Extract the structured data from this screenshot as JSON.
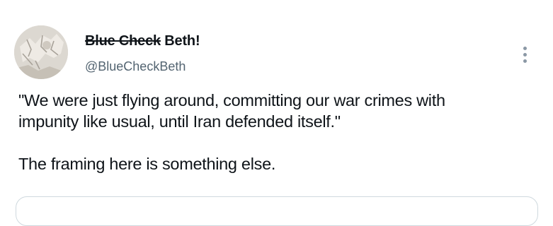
{
  "author": {
    "name_struck": "Blue Check",
    "name_rest": "Beth!",
    "handle": "@BlueCheckBeth",
    "avatar_icon": "avatar-photo-icon"
  },
  "menu": {
    "icon": "more-vertical-icon"
  },
  "tweet": {
    "line1": "\"We were just flying around, committing our war crimes with",
    "line2": "impunity like usual, until Iran defended itself.\"",
    "line3": "The framing here is something else."
  },
  "colors": {
    "text": "#0f1419",
    "secondary": "#536471",
    "border": "#cfd9de"
  }
}
